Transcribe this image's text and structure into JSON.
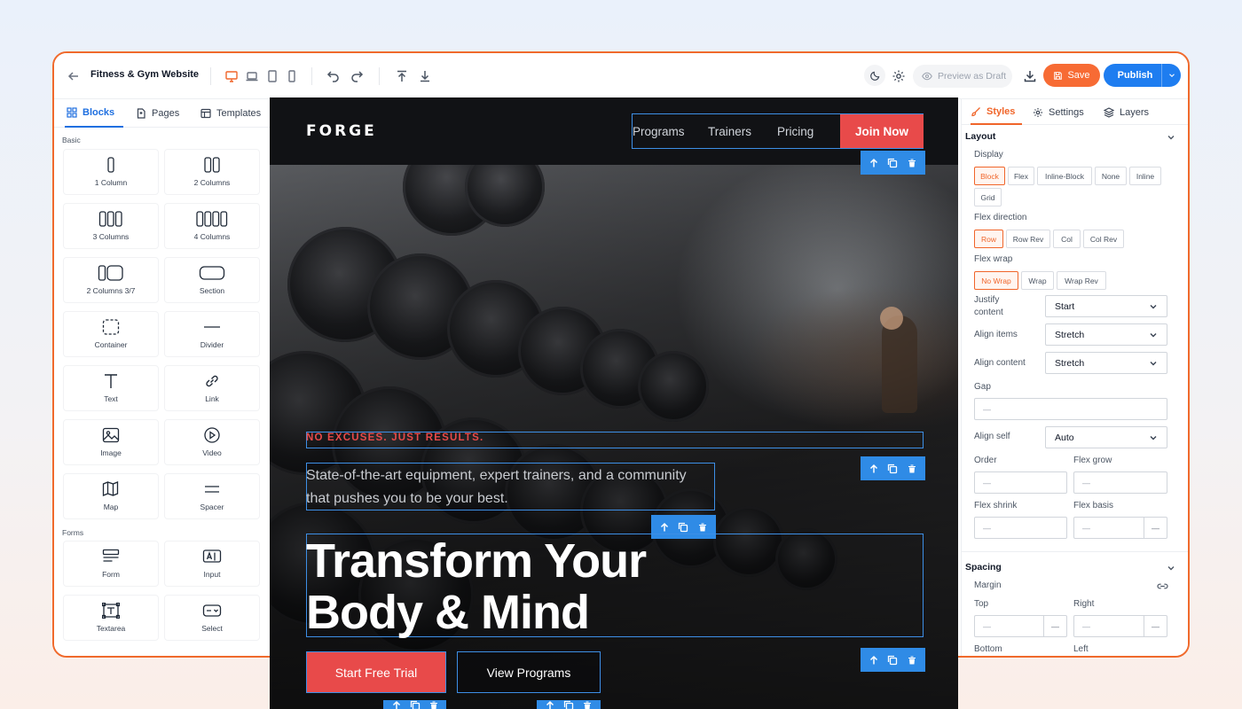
{
  "app": {
    "title": "Fitness & Gym Website",
    "preview_label": "Preview as Draft",
    "save_label": "Save",
    "publish_label": "Publish"
  },
  "left_panel": {
    "tabs": [
      {
        "label": "Blocks",
        "icon": "grid-icon"
      },
      {
        "label": "Pages",
        "icon": "page-icon"
      },
      {
        "label": "Templates",
        "icon": "template-icon"
      }
    ],
    "basic_label": "Basic",
    "forms_label": "Forms",
    "basic_blocks": [
      {
        "label": "1 Column",
        "icon": "one-column-icon"
      },
      {
        "label": "2 Columns",
        "icon": "two-columns-icon"
      },
      {
        "label": "3 Columns",
        "icon": "three-columns-icon"
      },
      {
        "label": "4 Columns",
        "icon": "four-columns-icon"
      },
      {
        "label": "2 Columns 3/7",
        "icon": "two-columns-37-icon"
      },
      {
        "label": "Section",
        "icon": "section-icon"
      },
      {
        "label": "Container",
        "icon": "container-icon"
      },
      {
        "label": "Divider",
        "icon": "divider-icon"
      },
      {
        "label": "Text",
        "icon": "text-icon"
      },
      {
        "label": "Link",
        "icon": "link-icon"
      },
      {
        "label": "Image",
        "icon": "image-icon"
      },
      {
        "label": "Video",
        "icon": "video-icon"
      },
      {
        "label": "Map",
        "icon": "map-icon"
      },
      {
        "label": "Spacer",
        "icon": "spacer-icon"
      }
    ],
    "form_blocks": [
      {
        "label": "Form",
        "icon": "form-icon"
      },
      {
        "label": "Input",
        "icon": "input-icon"
      },
      {
        "label": "Textarea",
        "icon": "textarea-icon"
      },
      {
        "label": "Select",
        "icon": "select-icon"
      }
    ]
  },
  "canvas": {
    "logo": "FORGE",
    "nav_links": [
      "Programs",
      "Trainers",
      "Pricing"
    ],
    "join_label": "Join Now",
    "tagline": "NO EXCUSES. JUST RESULTS.",
    "subtext": "State-of-the-art equipment, expert trainers, and a community that pushes you to be your best.",
    "headline_line1": "Transform Your",
    "headline_line2": "Body & Mind",
    "primary_cta": "Start Free Trial",
    "secondary_cta": "View Programs",
    "accent_color": "#e84a4a",
    "selection_color": "#3d8fe6"
  },
  "right_panel": {
    "tabs": [
      {
        "label": "Styles",
        "icon": "brush-icon"
      },
      {
        "label": "Settings",
        "icon": "gear-icon"
      },
      {
        "label": "Layers",
        "icon": "layers-icon"
      }
    ],
    "layout_title": "Layout",
    "display_label": "Display",
    "display_options": [
      "Block",
      "Flex",
      "Inline-Block",
      "None",
      "Inline",
      "Grid"
    ],
    "display_selected": "Block",
    "flex_direction_label": "Flex direction",
    "flex_direction_options": [
      "Row",
      "Row Rev",
      "Col",
      "Col Rev"
    ],
    "flex_direction_selected": "Row",
    "flex_wrap_label": "Flex wrap",
    "flex_wrap_options": [
      "No Wrap",
      "Wrap",
      "Wrap Rev"
    ],
    "flex_wrap_selected": "No Wrap",
    "justify_label_1": "Justify",
    "justify_label_2": "content",
    "justify_value": "Start",
    "align_items_label": "Align items",
    "align_items_value": "Stretch",
    "align_content_label": "Align content",
    "align_content_value": "Stretch",
    "gap_label": "Gap",
    "gap_placeholder": "—",
    "align_self_label": "Align self",
    "align_self_value": "Auto",
    "order_label": "Order",
    "flex_grow_label": "Flex grow",
    "flex_shrink_label": "Flex shrink",
    "flex_basis_label": "Flex basis",
    "empty_value": "—",
    "spacing_title": "Spacing",
    "margin_label": "Margin",
    "top_label": "Top",
    "right_label": "Right",
    "bottom_label": "Bottom",
    "left_label": "Left"
  }
}
